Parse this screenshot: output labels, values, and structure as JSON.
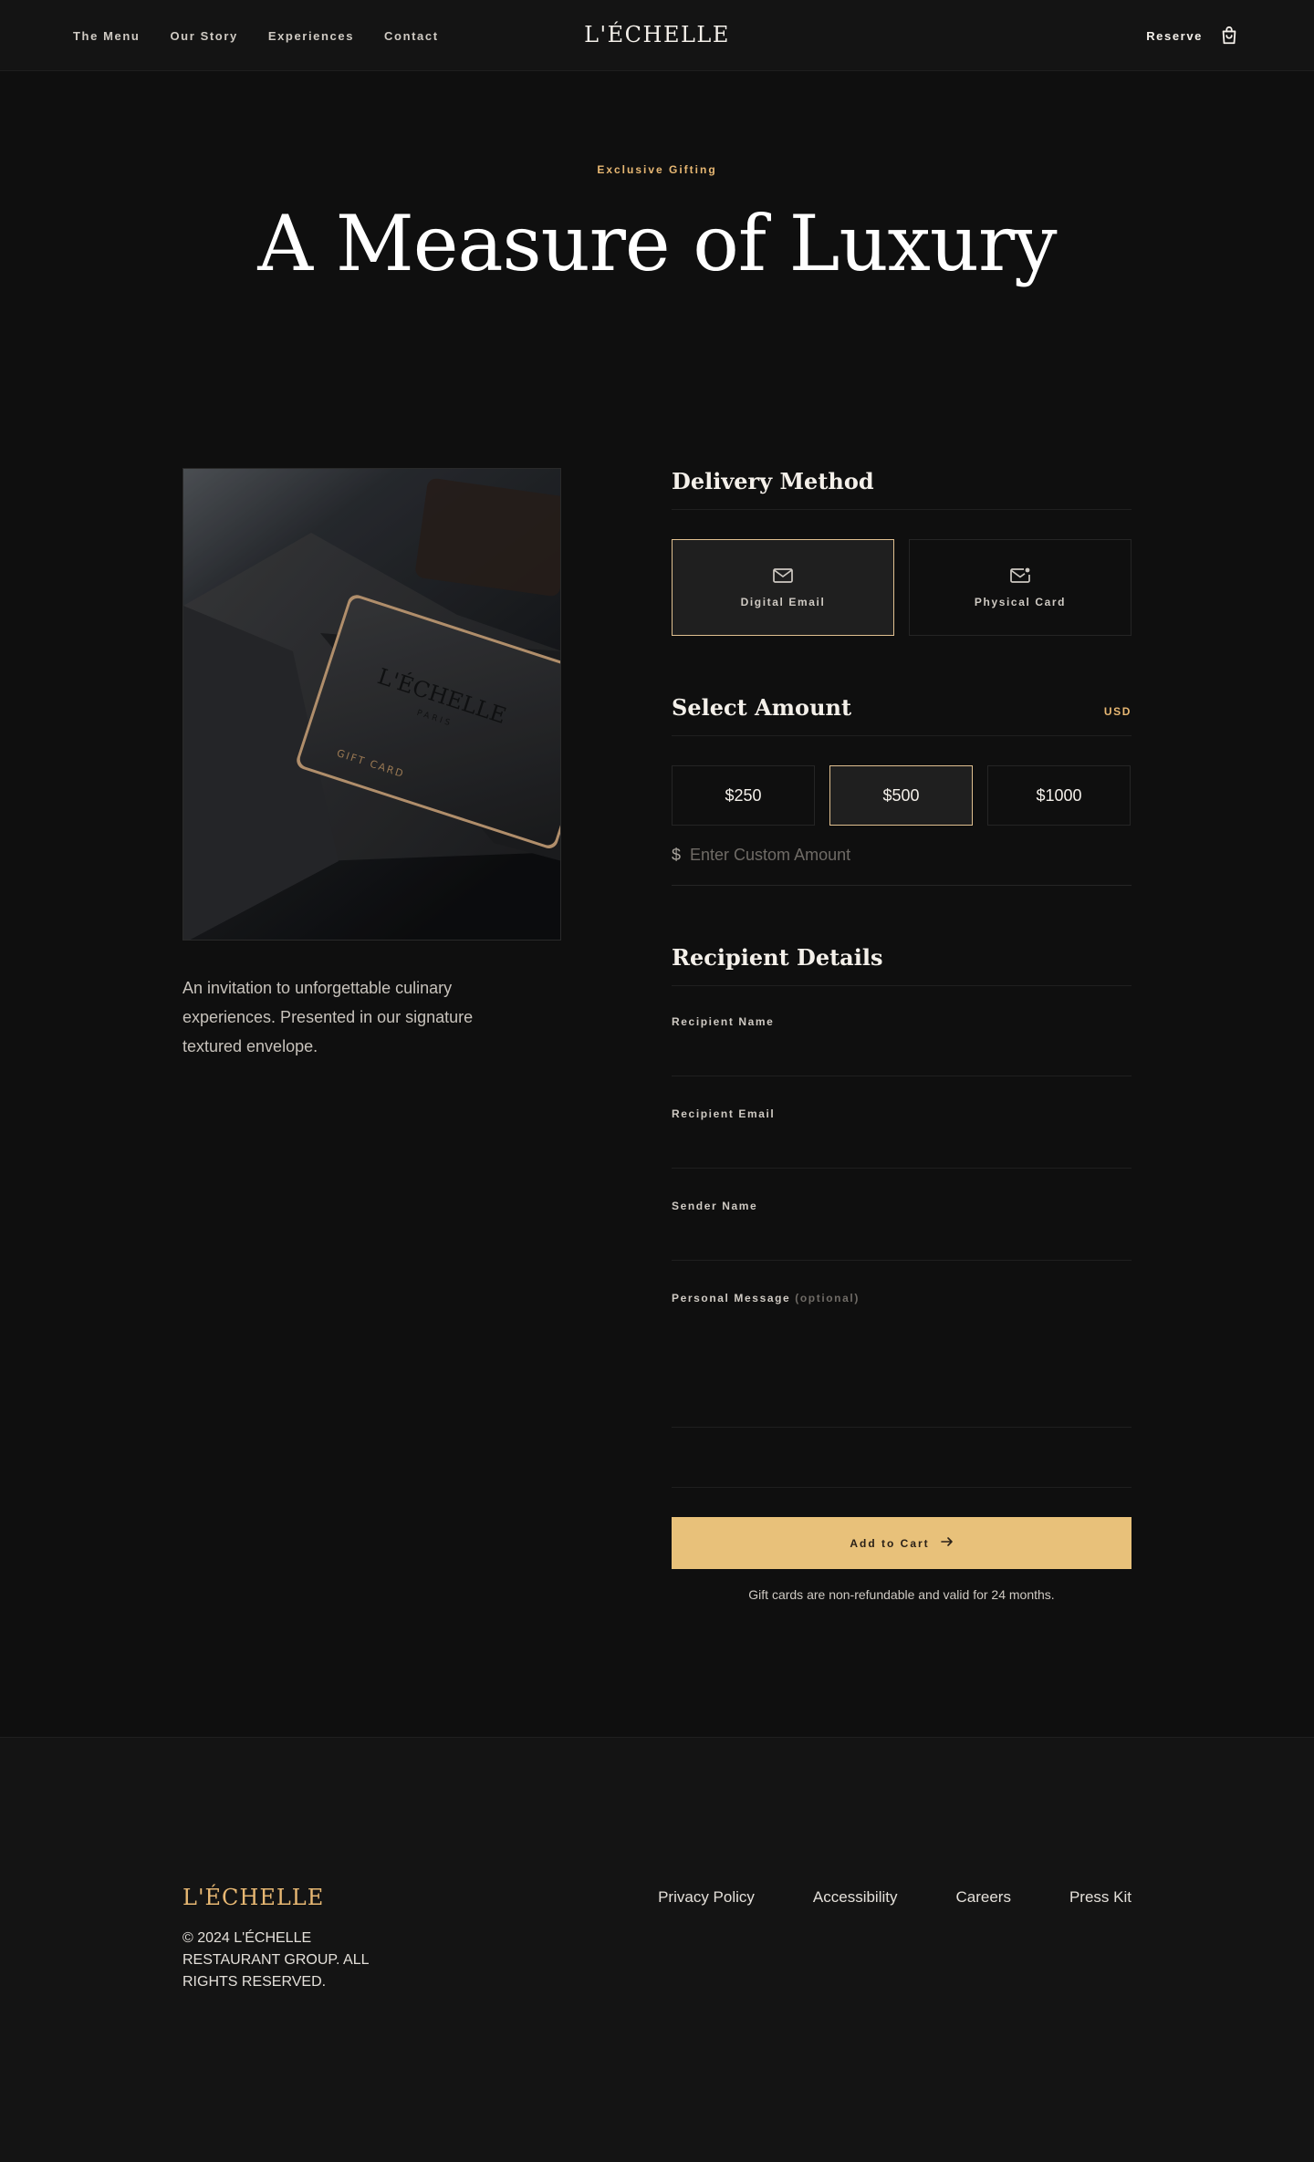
{
  "header": {
    "nav": [
      "The Menu",
      "Our Story",
      "Experiences",
      "Contact"
    ],
    "brand": "L'ÉCHELLE",
    "reserve": "Reserve",
    "cart_icon": "shopping-bag-icon"
  },
  "hero": {
    "eyebrow": "Exclusive Gifting",
    "title": "A Measure of Luxury"
  },
  "product": {
    "image_alt": "L'Échelle gift card in textured envelope",
    "card_brand": "L'ÉCHELLE",
    "card_city": "PARIS",
    "card_label": "GIFT CARD",
    "description": "An invitation to unforgettable culinary experiences. Presented in our signature textured envelope."
  },
  "delivery": {
    "title": "Delivery Method",
    "options": [
      {
        "label": "Digital Email",
        "icon": "mail-icon",
        "selected": true
      },
      {
        "label": "Physical Card",
        "icon": "mail-notification-icon",
        "selected": false
      }
    ]
  },
  "amount": {
    "title": "Select Amount",
    "currency": "USD",
    "options": [
      {
        "label": "$250",
        "selected": false
      },
      {
        "label": "$500",
        "selected": true
      },
      {
        "label": "$1000",
        "selected": false
      }
    ],
    "custom_prefix": "$",
    "custom_placeholder": "Enter Custom Amount"
  },
  "recipient": {
    "title": "Recipient Details",
    "name_label": "Recipient Name",
    "email_label": "Recipient Email",
    "sender_label": "Sender Name",
    "message_label": "Personal Message",
    "message_optional": "(optional)"
  },
  "cta": {
    "label": "Add to Cart",
    "icon": "arrow-right-icon",
    "fine_print": "Gift cards are non-refundable and valid for 24 months."
  },
  "footer": {
    "brand": "L'ÉCHELLE",
    "copyright": "© 2024 L'ÉCHELLE Restaurant Group. All Rights Reserved.",
    "links": [
      "Privacy Policy",
      "Accessibility",
      "Careers",
      "Press Kit"
    ]
  },
  "colors": {
    "accent": "#e8b873",
    "button": "#e8c17a",
    "background": "#0f0f0f"
  }
}
